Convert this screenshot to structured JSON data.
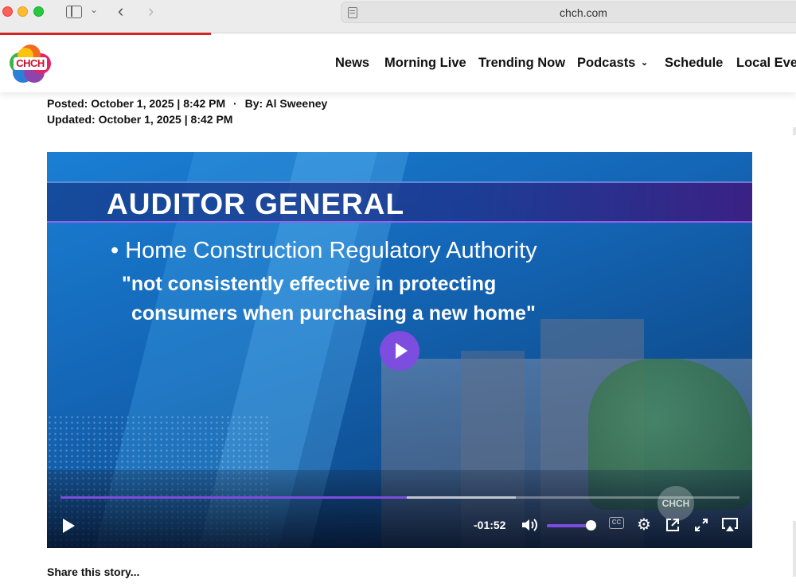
{
  "browser": {
    "url": "chch.com"
  },
  "site": {
    "logo_text": "CHCH",
    "nav": [
      {
        "label": "News"
      },
      {
        "label": "Morning Live"
      },
      {
        "label": "Trending Now"
      },
      {
        "label": "Podcasts",
        "has_dropdown": true
      },
      {
        "label": "Schedule"
      },
      {
        "label": "Local Eve"
      }
    ]
  },
  "article": {
    "posted_label": "Posted:",
    "posted_value": "October 1, 2025 | 8:42 PM",
    "separator": "·",
    "byline_label": "By:",
    "byline_value": "Al Sweeney",
    "updated_label": "Updated:",
    "updated_value": "October 1, 2025 | 8:42 PM",
    "share_text": "Share this story..."
  },
  "video": {
    "title_card": "AUDITOR GENERAL",
    "bullet": "• Home Construction Regulatory Authority",
    "quote_line1": "\"not consistently effective in protecting",
    "quote_line2": "consumers when purchasing a new home\"",
    "watermark": "CHCH",
    "time_remaining": "-01:52",
    "progress_fraction": 0.51,
    "buffered_fraction": 0.67,
    "volume_fraction": 1.0,
    "cc_label": "CC",
    "accent_color": "#7c4dde"
  },
  "icons": {
    "play": "play-icon",
    "volume": "volume-icon",
    "captions": "cc-icon",
    "settings": "gear-icon",
    "popout": "popout-icon",
    "fullscreen": "fullscreen-icon",
    "airplay": "airplay-icon"
  }
}
